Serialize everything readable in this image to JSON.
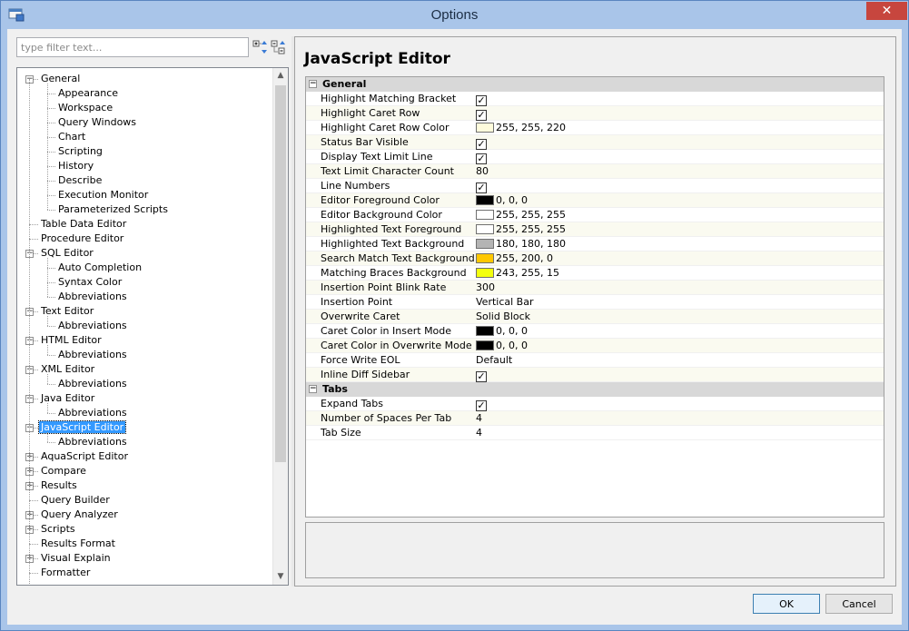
{
  "window": {
    "title": "Options"
  },
  "filter": {
    "placeholder": "type filter text..."
  },
  "tree": [
    {
      "label": "General",
      "level": 0,
      "expander": "-"
    },
    {
      "label": "Appearance",
      "level": 1
    },
    {
      "label": "Workspace",
      "level": 1
    },
    {
      "label": "Query Windows",
      "level": 1
    },
    {
      "label": "Chart",
      "level": 1
    },
    {
      "label": "Scripting",
      "level": 1
    },
    {
      "label": "History",
      "level": 1
    },
    {
      "label": "Describe",
      "level": 1
    },
    {
      "label": "Execution Monitor",
      "level": 1
    },
    {
      "label": "Parameterized Scripts",
      "level": 1
    },
    {
      "label": "Table Data Editor",
      "level": 0
    },
    {
      "label": "Procedure Editor",
      "level": 0
    },
    {
      "label": "SQL Editor",
      "level": 0,
      "expander": "-"
    },
    {
      "label": "Auto Completion",
      "level": 1
    },
    {
      "label": "Syntax Color",
      "level": 1
    },
    {
      "label": "Abbreviations",
      "level": 1
    },
    {
      "label": "Text Editor",
      "level": 0,
      "expander": "-"
    },
    {
      "label": "Abbreviations",
      "level": 1
    },
    {
      "label": "HTML Editor",
      "level": 0,
      "expander": "-"
    },
    {
      "label": "Abbreviations",
      "level": 1
    },
    {
      "label": "XML Editor",
      "level": 0,
      "expander": "-"
    },
    {
      "label": "Abbreviations",
      "level": 1
    },
    {
      "label": "Java Editor",
      "level": 0,
      "expander": "-"
    },
    {
      "label": "Abbreviations",
      "level": 1
    },
    {
      "label": "JavaScript Editor",
      "level": 0,
      "expander": "-",
      "selected": true
    },
    {
      "label": "Abbreviations",
      "level": 1
    },
    {
      "label": "AquaScript Editor",
      "level": 0,
      "expander": "+"
    },
    {
      "label": "Compare",
      "level": 0,
      "expander": "+"
    },
    {
      "label": "Results",
      "level": 0,
      "expander": "+"
    },
    {
      "label": "Query Builder",
      "level": 0
    },
    {
      "label": "Query Analyzer",
      "level": 0,
      "expander": "+"
    },
    {
      "label": "Scripts",
      "level": 0,
      "expander": "+"
    },
    {
      "label": "Results Format",
      "level": 0
    },
    {
      "label": "Visual Explain",
      "level": 0,
      "expander": "+"
    },
    {
      "label": "Formatter",
      "level": 0
    }
  ],
  "page": {
    "title": "JavaScript Editor"
  },
  "categories": [
    {
      "name": "General",
      "properties": [
        {
          "name": "Highlight Matching Bracket",
          "type": "check",
          "checked": true
        },
        {
          "name": "Highlight Caret Row",
          "type": "check",
          "checked": true
        },
        {
          "name": "Highlight Caret Row Color",
          "type": "color",
          "color": "#fffcdc",
          "value": "255, 255, 220"
        },
        {
          "name": "Status Bar Visible",
          "type": "check",
          "checked": true
        },
        {
          "name": "Display Text Limit Line",
          "type": "check",
          "checked": true
        },
        {
          "name": "Text Limit Character Count",
          "type": "text",
          "value": "80"
        },
        {
          "name": "Line Numbers",
          "type": "check",
          "checked": true
        },
        {
          "name": "Editor Foreground Color",
          "type": "color",
          "color": "#000000",
          "value": "0, 0, 0"
        },
        {
          "name": "Editor Background Color",
          "type": "color",
          "color": "#ffffff",
          "value": "255, 255, 255"
        },
        {
          "name": "Highlighted Text Foreground",
          "type": "color",
          "color": "#ffffff",
          "value": "255, 255, 255"
        },
        {
          "name": "Highlighted Text Background",
          "type": "color",
          "color": "#b4b4b4",
          "value": "180, 180, 180"
        },
        {
          "name": "Search Match Text Background",
          "type": "color",
          "color": "#ffc800",
          "value": "255, 200, 0"
        },
        {
          "name": "Matching Braces Background",
          "type": "color",
          "color": "#f3ff0f",
          "value": "243, 255, 15"
        },
        {
          "name": "Insertion Point Blink Rate",
          "type": "text",
          "value": "300"
        },
        {
          "name": "Insertion Point",
          "type": "text",
          "value": "Vertical Bar"
        },
        {
          "name": "Overwrite Caret",
          "type": "text",
          "value": "Solid Block"
        },
        {
          "name": "Caret Color in Insert Mode",
          "type": "color",
          "color": "#000000",
          "value": "0, 0, 0"
        },
        {
          "name": "Caret Color in Overwrite Mode",
          "type": "color",
          "color": "#000000",
          "value": "0, 0, 0"
        },
        {
          "name": "Force Write EOL",
          "type": "text",
          "value": "Default"
        },
        {
          "name": "Inline Diff Sidebar",
          "type": "check",
          "checked": true
        }
      ]
    },
    {
      "name": "Tabs",
      "properties": [
        {
          "name": "Expand Tabs",
          "type": "check",
          "checked": true
        },
        {
          "name": "Number of Spaces Per Tab",
          "type": "text",
          "value": "4"
        },
        {
          "name": "Tab Size",
          "type": "text",
          "value": "4"
        }
      ]
    }
  ],
  "buttons": {
    "ok": "OK",
    "cancel": "Cancel"
  }
}
